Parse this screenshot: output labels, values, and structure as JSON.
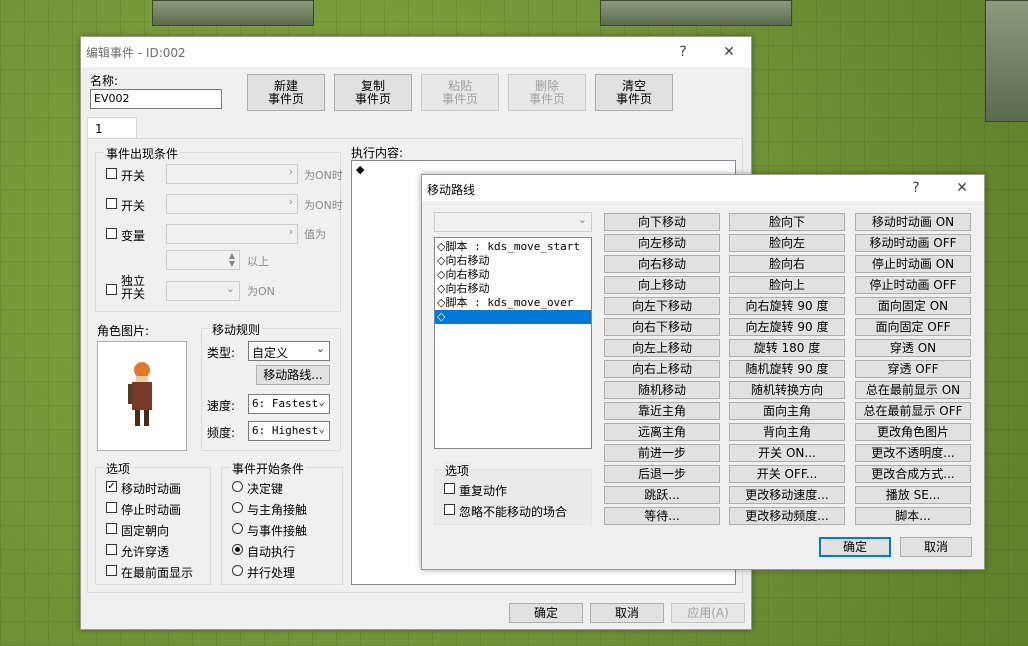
{
  "main": {
    "title": "编辑事件 - ID:002",
    "help": "?",
    "close": "✕",
    "name_label": "名称:",
    "name_value": "EV002",
    "buttons": [
      "新建\n事件页",
      "复制\n事件页",
      "粘贴\n事件页",
      "删除\n事件页",
      "清空\n事件页"
    ],
    "tab": "1",
    "conditions": {
      "title": "事件出现条件",
      "switch1": "开关",
      "switch1_suffix": "为ON时",
      "switch2": "开关",
      "switch2_suffix": "为ON时",
      "variable": "变量",
      "variable_suffix": "值为",
      "above": "以上",
      "self_switch": "独立\n开关",
      "self_suffix": "为ON"
    },
    "graphic_label": "角色图片:",
    "movement": {
      "title": "移动规则",
      "type_label": "类型:",
      "type_value": "自定义",
      "route_button": "移动路线...",
      "speed_label": "速度:",
      "speed_value": "6: Fastest",
      "freq_label": "频度:",
      "freq_value": "6: Highest"
    },
    "options": {
      "title": "选项",
      "items": [
        {
          "label": "移动时动画",
          "checked": true
        },
        {
          "label": "停止时动画",
          "checked": false
        },
        {
          "label": "固定朝向",
          "checked": false
        },
        {
          "label": "允许穿透",
          "checked": false
        },
        {
          "label": "在最前面显示",
          "checked": false
        }
      ]
    },
    "trigger": {
      "title": "事件开始条件",
      "items": [
        {
          "label": "决定键",
          "on": false
        },
        {
          "label": "与主角接触",
          "on": false
        },
        {
          "label": "与事件接触",
          "on": false
        },
        {
          "label": "自动执行",
          "on": true
        },
        {
          "label": "并行处理",
          "on": false
        }
      ]
    },
    "contents_label": "执行内容:",
    "contents_marker": "◆",
    "ok": "确定",
    "cancel": "取消",
    "apply": "应用(A)"
  },
  "route": {
    "title": "移动路线",
    "help": "?",
    "close": "✕",
    "list": [
      {
        "mark": "◇",
        "text": "脚本 : kds_move_start",
        "selected": false
      },
      {
        "mark": "◇",
        "text": "向右移动",
        "selected": false
      },
      {
        "mark": "◇",
        "text": "向右移动",
        "selected": false
      },
      {
        "mark": "◇",
        "text": "向右移动",
        "selected": false
      },
      {
        "mark": "◇",
        "text": "脚本 : kds_move_over",
        "selected": false
      },
      {
        "mark": "◇",
        "text": "",
        "selected": true
      }
    ],
    "options_title": "选项",
    "repeat": "重复动作",
    "skip": "忽略不能移动的场合",
    "col1": [
      "向下移动",
      "向左移动",
      "向右移动",
      "向上移动",
      "向左下移动",
      "向右下移动",
      "向左上移动",
      "向右上移动",
      "随机移动",
      "靠近主角",
      "远离主角",
      "前进一步",
      "后退一步",
      "跳跃...",
      "等待..."
    ],
    "col2": [
      "脸向下",
      "脸向左",
      "脸向右",
      "脸向上",
      "向右旋转 90 度",
      "向左旋转 90 度",
      "旋转 180 度",
      "随机旋转 90 度",
      "随机转换方向",
      "面向主角",
      "背向主角",
      "开关 ON...",
      "开关 OFF...",
      "更改移动速度...",
      "更改移动频度..."
    ],
    "col3": [
      "移动时动画 ON",
      "移动时动画 OFF",
      "停止时动画 ON",
      "停止时动画 OFF",
      "面向固定 ON",
      "面向固定 OFF",
      "穿透 ON",
      "穿透 OFF",
      "总在最前显示 ON",
      "总在最前显示 OFF",
      "更改角色图片",
      "更改不透明度...",
      "更改合成方式...",
      "播放 SE...",
      "脚本..."
    ],
    "ok": "确定",
    "cancel": "取消"
  }
}
